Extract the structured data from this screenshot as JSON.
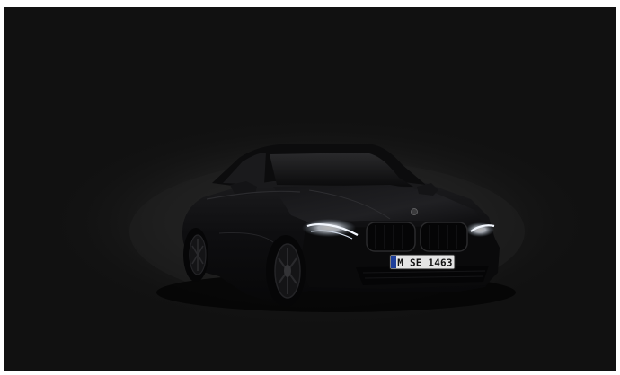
{
  "scene": {
    "subject": "car",
    "background_color": "#111111",
    "body_color": "#0d0d0e"
  },
  "license_plate": {
    "text": "M SE 1463"
  }
}
